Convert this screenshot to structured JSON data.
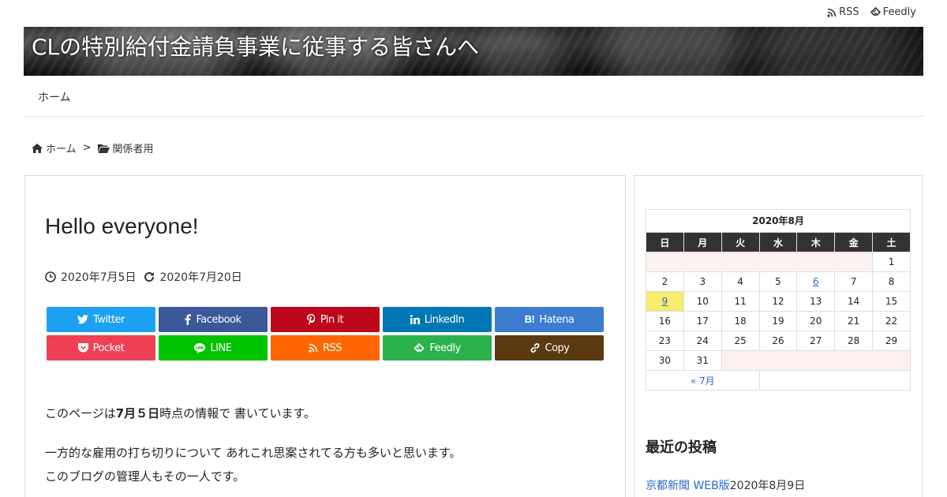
{
  "topbar": {
    "rss_label": "RSS",
    "feedly_label": "Feedly"
  },
  "header": {
    "site_title": "CLの特別給付金請負事業に従事する皆さんへ"
  },
  "nav": {
    "items": [
      {
        "label": "ホーム"
      }
    ]
  },
  "breadcrumb": {
    "home": "ホーム",
    "separator": ">",
    "category": "関係者用"
  },
  "article": {
    "title": "Hello everyone!",
    "published": "2020年7月5日",
    "updated": "2020年7月20日",
    "share": [
      {
        "label": "Twitter",
        "icon": "twitter-icon",
        "color": "#1da1f2"
      },
      {
        "label": "Facebook",
        "icon": "facebook-icon",
        "color": "#3b5998"
      },
      {
        "label": "Pin it",
        "icon": "pinterest-icon",
        "color": "#bd081c"
      },
      {
        "label": "LinkedIn",
        "icon": "linkedin-icon",
        "color": "#0077b5"
      },
      {
        "label": "Hatena",
        "icon": "hatena-icon",
        "color": "#3c7dd1"
      },
      {
        "label": "Pocket",
        "icon": "pocket-icon",
        "color": "#ef4056"
      },
      {
        "label": "LINE",
        "icon": "line-icon",
        "color": "#00c300"
      },
      {
        "label": "RSS",
        "icon": "rss-icon",
        "color": "#ff6600"
      },
      {
        "label": "Feedly",
        "icon": "feedly-icon",
        "color": "#2bb24c"
      },
      {
        "label": "Copy",
        "icon": "link-icon",
        "color": "#5b3a12"
      }
    ],
    "para1_pre": "このページは",
    "para1_bold": "7月５日",
    "para1_post": "時点の情報で 書いています。",
    "para2_line1": "一方的な雇用の打ち切りについて あれこれ思案されてる方も多いと思います。",
    "para2_line2": "このブログの管理人もその一人です。"
  },
  "calendar": {
    "caption": "2020年8月",
    "weekdays": [
      "日",
      "月",
      "火",
      "水",
      "木",
      "金",
      "土"
    ],
    "weeks": [
      [
        "",
        "",
        "",
        "",
        "",
        "",
        "1"
      ],
      [
        "2",
        "3",
        "4",
        "5",
        "6",
        "7",
        "8"
      ],
      [
        "9",
        "10",
        "11",
        "12",
        "13",
        "14",
        "15"
      ],
      [
        "16",
        "17",
        "18",
        "19",
        "20",
        "21",
        "22"
      ],
      [
        "23",
        "24",
        "25",
        "26",
        "27",
        "28",
        "29"
      ],
      [
        "30",
        "31",
        "",
        "",
        "",
        "",
        ""
      ]
    ],
    "linked_days": [
      "6",
      "9"
    ],
    "today": "9",
    "prev_label": "« 7月"
  },
  "recent_posts": {
    "heading": "最近の投稿",
    "items": [
      {
        "title": "京都新聞 WEB版",
        "date": "2020年8月9日"
      }
    ]
  }
}
